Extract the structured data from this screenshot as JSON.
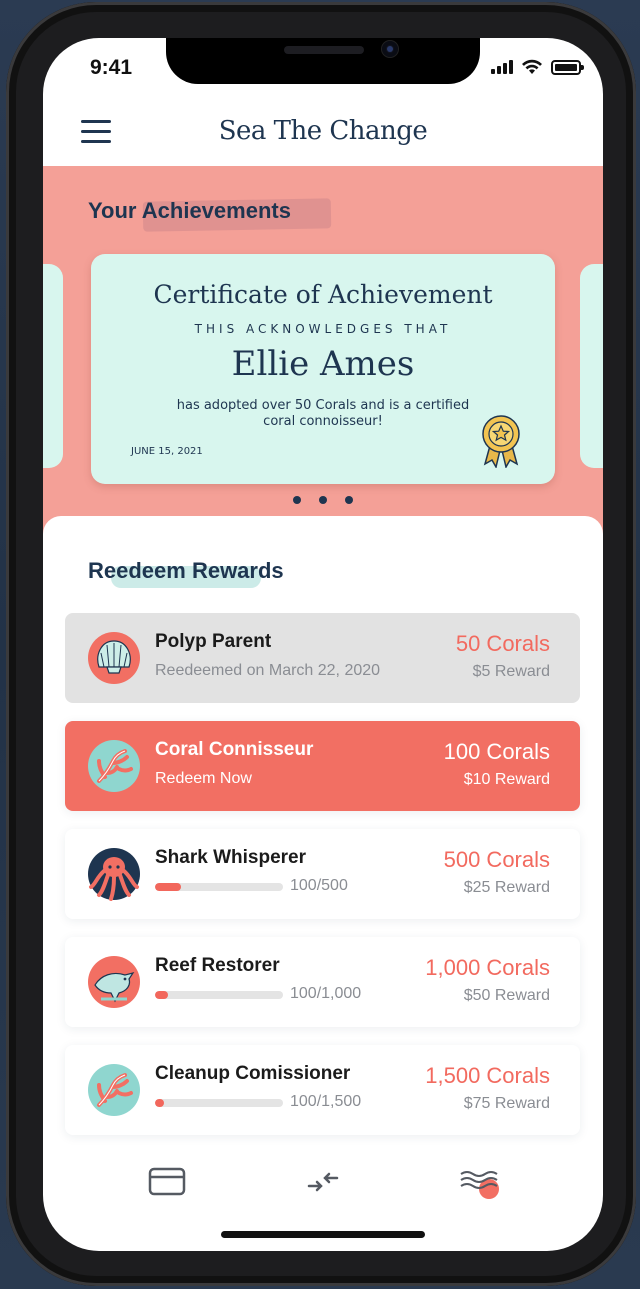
{
  "status_bar": {
    "time": "9:41"
  },
  "header": {
    "title": "Sea The Change",
    "menu_icon": "hamburger-menu-icon"
  },
  "achievements": {
    "title": "Your Achievements",
    "certificate": {
      "title": "Certificate of Achievement",
      "subtitle": "THIS ACKNOWLEDGES THAT",
      "recipient": "Ellie Ames",
      "description": "has adopted over 50 Corals and is a certified coral connoisseur!",
      "date": "JUNE 15, 2021",
      "badge_icon": "award-ribbon-icon"
    },
    "pagination_count": 3
  },
  "rewards": {
    "title": "Reedeem Rewards",
    "items": [
      {
        "name": "Polyp Parent",
        "status": "Reedeemed on March 22, 2020",
        "cost": "50 Corals",
        "reward": "$5 Reward",
        "state": "redeemed",
        "icon": "shell-icon"
      },
      {
        "name": "Coral Connisseur",
        "status": "Redeem Now",
        "cost": "100 Corals",
        "reward": "$10 Reward",
        "state": "available",
        "icon": "coral-icon"
      },
      {
        "name": "Shark Whisperer",
        "progress_text": "100/500",
        "progress": 0.2,
        "cost": "500 Corals",
        "reward": "$25 Reward",
        "state": "locked",
        "icon": "octopus-icon"
      },
      {
        "name": "Reef Restorer",
        "progress_text": "100/1,000",
        "progress": 0.1,
        "cost": "1,000 Corals",
        "reward": "$50 Reward",
        "state": "locked",
        "icon": "dolphin-icon"
      },
      {
        "name": "Cleanup Comissioner",
        "progress_text": "100/1,500",
        "progress": 0.067,
        "cost": "1,500 Corals",
        "reward": "$75 Reward",
        "state": "locked",
        "icon": "coral-icon"
      }
    ]
  },
  "tab_bar": {
    "tabs": [
      {
        "icon": "card-icon"
      },
      {
        "icon": "transfer-arrows-icon"
      },
      {
        "icon": "waves-icon",
        "active": true
      }
    ]
  },
  "colors": {
    "accent": "#f26f63",
    "navy": "#1e3550",
    "mint": "#d8f6ee",
    "salmon_bg": "#f4a097"
  }
}
